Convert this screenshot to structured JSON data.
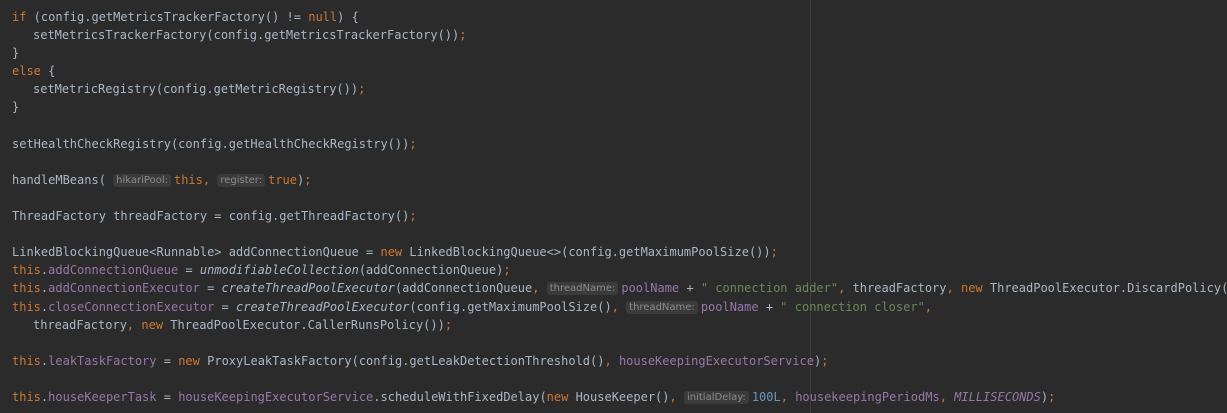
{
  "editor": {
    "lines": [
      [
        {
          "t": "if",
          "c": "kw"
        },
        {
          "t": " (config.getMetricsTrackerFactory() != "
        },
        {
          "t": "null",
          "c": "kw"
        },
        {
          "t": ") {"
        }
      ],
      [
        {
          "indent": 1
        },
        {
          "t": "setMetricsTrackerFactory(config.getMetricsTrackerFactory())"
        },
        {
          "t": ";",
          "c": "kw"
        }
      ],
      [
        {
          "t": "}"
        }
      ],
      [
        {
          "t": "else",
          "c": "kw"
        },
        {
          "t": " {"
        }
      ],
      [
        {
          "indent": 1
        },
        {
          "t": "setMetricRegistry(config.getMetricRegistry())"
        },
        {
          "t": ";",
          "c": "kw"
        }
      ],
      [
        {
          "t": "}"
        }
      ],
      [],
      [
        {
          "t": "setHealthCheckRegistry(config.getHealthCheckRegistry())"
        },
        {
          "t": ";",
          "c": "kw"
        }
      ],
      [],
      [
        {
          "t": "handleMBeans( "
        },
        {
          "t": "hikariPool:",
          "c": "hint"
        },
        {
          "t": "this",
          "c": "kw"
        },
        {
          "t": ",",
          "c": "kw"
        },
        {
          "t": " "
        },
        {
          "t": "register:",
          "c": "hint"
        },
        {
          "t": "true",
          "c": "kw"
        },
        {
          "t": ")"
        },
        {
          "t": ";",
          "c": "kw"
        }
      ],
      [],
      [
        {
          "t": "ThreadFactory threadFactory = config.getThreadFactory()"
        },
        {
          "t": ";",
          "c": "kw"
        }
      ],
      [],
      [
        {
          "t": "LinkedBlockingQueue<Runnable> addConnectionQueue = "
        },
        {
          "t": "new",
          "c": "kw"
        },
        {
          "t": " LinkedBlockingQueue<>(config.getMaximumPoolSize())"
        },
        {
          "t": ";",
          "c": "kw"
        }
      ],
      [
        {
          "t": "this",
          "c": "kw"
        },
        {
          "t": "."
        },
        {
          "t": "addConnectionQueue",
          "c": "fld"
        },
        {
          "t": " = "
        },
        {
          "t": "unmodifiableCollection",
          "c": "it"
        },
        {
          "t": "(addConnectionQueue)"
        },
        {
          "t": ";",
          "c": "kw"
        }
      ],
      [
        {
          "t": "this",
          "c": "kw"
        },
        {
          "t": "."
        },
        {
          "t": "addConnectionExecutor",
          "c": "fld"
        },
        {
          "t": " = "
        },
        {
          "t": "createThreadPoolExecutor",
          "c": "it"
        },
        {
          "t": "(addConnectionQueue"
        },
        {
          "t": ",",
          "c": "kw"
        },
        {
          "t": " "
        },
        {
          "t": "threadName:",
          "c": "hint"
        },
        {
          "t": "poolName",
          "c": "fld"
        },
        {
          "t": " + "
        },
        {
          "t": "\" connection adder\"",
          "c": "str"
        },
        {
          "t": ",",
          "c": "kw"
        },
        {
          "t": " threadFactory"
        },
        {
          "t": ",",
          "c": "kw"
        },
        {
          "t": " "
        },
        {
          "t": "new",
          "c": "kw"
        },
        {
          "t": " ThreadPoolExecutor.DiscardPolicy())"
        },
        {
          "t": ";",
          "c": "kw"
        }
      ],
      [
        {
          "t": "this",
          "c": "kw"
        },
        {
          "t": "."
        },
        {
          "t": "closeConnectionExecutor",
          "c": "fld"
        },
        {
          "t": " = "
        },
        {
          "t": "createThreadPoolExecutor",
          "c": "it"
        },
        {
          "t": "(config.getMaximumPoolSize()"
        },
        {
          "t": ",",
          "c": "kw"
        },
        {
          "t": " "
        },
        {
          "t": "threadName:",
          "c": "hint"
        },
        {
          "t": "poolName",
          "c": "fld"
        },
        {
          "t": " + "
        },
        {
          "t": "\" connection closer\"",
          "c": "str"
        },
        {
          "t": ",",
          "c": "kw"
        }
      ],
      [
        {
          "indent": 1
        },
        {
          "t": "threadFactory"
        },
        {
          "t": ",",
          "c": "kw"
        },
        {
          "t": " "
        },
        {
          "t": "new",
          "c": "kw"
        },
        {
          "t": " ThreadPoolExecutor.CallerRunsPolicy())"
        },
        {
          "t": ";",
          "c": "kw"
        }
      ],
      [],
      [
        {
          "t": "this",
          "c": "kw"
        },
        {
          "t": "."
        },
        {
          "t": "leakTaskFactory",
          "c": "fld"
        },
        {
          "t": " = "
        },
        {
          "t": "new",
          "c": "kw"
        },
        {
          "t": " ProxyLeakTaskFactory(config.getLeakDetectionThreshold()"
        },
        {
          "t": ",",
          "c": "kw"
        },
        {
          "t": " "
        },
        {
          "t": "houseKeepingExecutorService",
          "c": "fld"
        },
        {
          "t": ")"
        },
        {
          "t": ";",
          "c": "kw"
        }
      ],
      [],
      [
        {
          "t": "this",
          "c": "kw"
        },
        {
          "t": "."
        },
        {
          "t": "houseKeeperTask",
          "c": "fld"
        },
        {
          "t": " = "
        },
        {
          "t": "houseKeepingExecutorService",
          "c": "fld"
        },
        {
          "t": ".scheduleWithFixedDelay("
        },
        {
          "t": "new",
          "c": "kw"
        },
        {
          "t": " HouseKeeper()"
        },
        {
          "t": ",",
          "c": "kw"
        },
        {
          "t": " "
        },
        {
          "t": "initialDelay:",
          "c": "hint"
        },
        {
          "t": "100L",
          "c": "num"
        },
        {
          "t": ",",
          "c": "kw"
        },
        {
          "t": " "
        },
        {
          "t": "housekeepingPeriodMs",
          "c": "fld"
        },
        {
          "t": ",",
          "c": "kw"
        },
        {
          "t": " "
        },
        {
          "t": "MILLISECONDS",
          "c": "const"
        },
        {
          "t": ")"
        },
        {
          "t": ";",
          "c": "kw"
        }
      ]
    ]
  },
  "colors": {
    "background": "#2b2b2b",
    "default_text": "#a9b7c6",
    "keyword": "#cc7832",
    "field": "#9876aa",
    "string": "#6a8759",
    "number": "#6897bb",
    "inlay_hint": "#8c8c8c"
  }
}
